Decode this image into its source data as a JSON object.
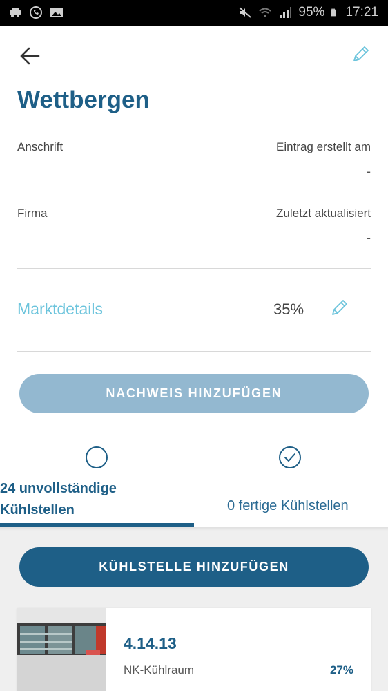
{
  "status_bar": {
    "icons_left": [
      "car-icon",
      "whatsapp-icon",
      "image-icon"
    ],
    "icons_right": [
      "mute-icon",
      "wifi-icon",
      "signal-icon",
      "battery-icon"
    ],
    "battery": "95%",
    "time": "17:21"
  },
  "header": {
    "title": "Wettbergen"
  },
  "info": {
    "address_label": "Anschrift",
    "created_label": "Eintrag erstellt am",
    "created_value": "-",
    "company_label": "Firma",
    "updated_label": "Zuletzt aktualisiert",
    "updated_value": "-"
  },
  "market_details": {
    "label": "Marktdetails",
    "progress_text": "35%",
    "progress": 0.35
  },
  "proof_button": "NACHWEIS HINZUFÜGEN",
  "tabs": [
    {
      "label": "24 unvollständige Kühlstellen",
      "icon": "circle-outline-icon",
      "active": true
    },
    {
      "label": "0 fertige Kühlstellen",
      "icon": "check-circle-icon",
      "active": false
    }
  ],
  "add_button": "KÜHLSTELLE HINZUFÜGEN",
  "list": [
    {
      "id": "4.14.13",
      "name": "NK-Kühlraum",
      "progress_text": "27%",
      "progress": 0.27
    }
  ],
  "colors": {
    "primary": "#1e5f87",
    "accent": "#6cc4dc",
    "disabled_button": "#93b8d0",
    "list_background": "#efefef"
  }
}
